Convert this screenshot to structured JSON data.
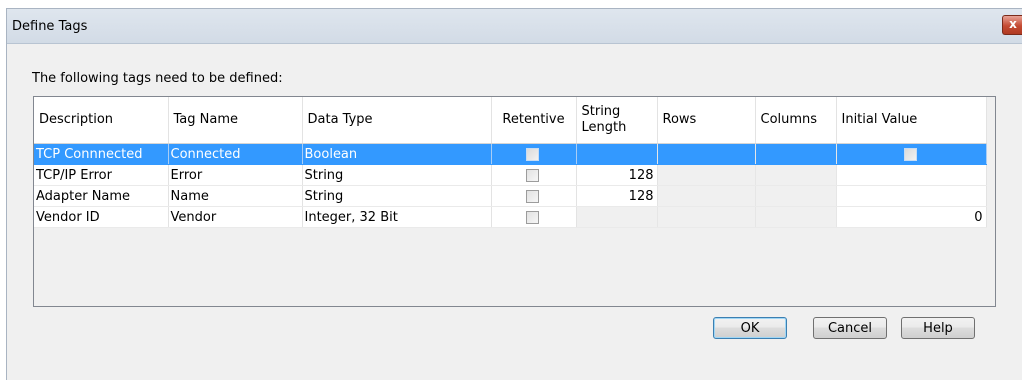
{
  "window": {
    "title": "Define Tags",
    "close_glyph": "x"
  },
  "prompt": "The following tags need to be defined:",
  "table": {
    "columns": [
      "Description",
      "Tag Name",
      "Data Type",
      "Retentive",
      "String Length",
      "Rows",
      "Columns",
      "Initial Value"
    ],
    "rows": [
      {
        "description": "TCP Connnected",
        "tag_name": "Connected",
        "data_type": "Boolean",
        "retentive": false,
        "string_length": "",
        "rows": "",
        "columns": "",
        "initial_value": "",
        "initial_checkbox": true,
        "selected": true
      },
      {
        "description": "TCP/IP Error",
        "tag_name": "Error",
        "data_type": "String",
        "retentive": false,
        "string_length": "128",
        "rows": "",
        "columns": "",
        "initial_value": "",
        "initial_checkbox": false,
        "selected": false
      },
      {
        "description": "Adapter Name",
        "tag_name": "Name",
        "data_type": "String",
        "retentive": false,
        "string_length": "128",
        "rows": "",
        "columns": "",
        "initial_value": "",
        "initial_checkbox": false,
        "selected": false
      },
      {
        "description": "Vendor ID",
        "tag_name": "Vendor",
        "data_type": "Integer, 32 Bit",
        "retentive": false,
        "string_length": "",
        "rows": "",
        "columns": "",
        "initial_value": "0",
        "initial_checkbox": false,
        "selected": false
      }
    ]
  },
  "buttons": {
    "ok": "OK",
    "cancel": "Cancel",
    "help": "Help"
  },
  "colors": {
    "selection": "#3399ff",
    "dialog_bg": "#f0f0f0",
    "disabled_cell": "#f0f0f0"
  }
}
